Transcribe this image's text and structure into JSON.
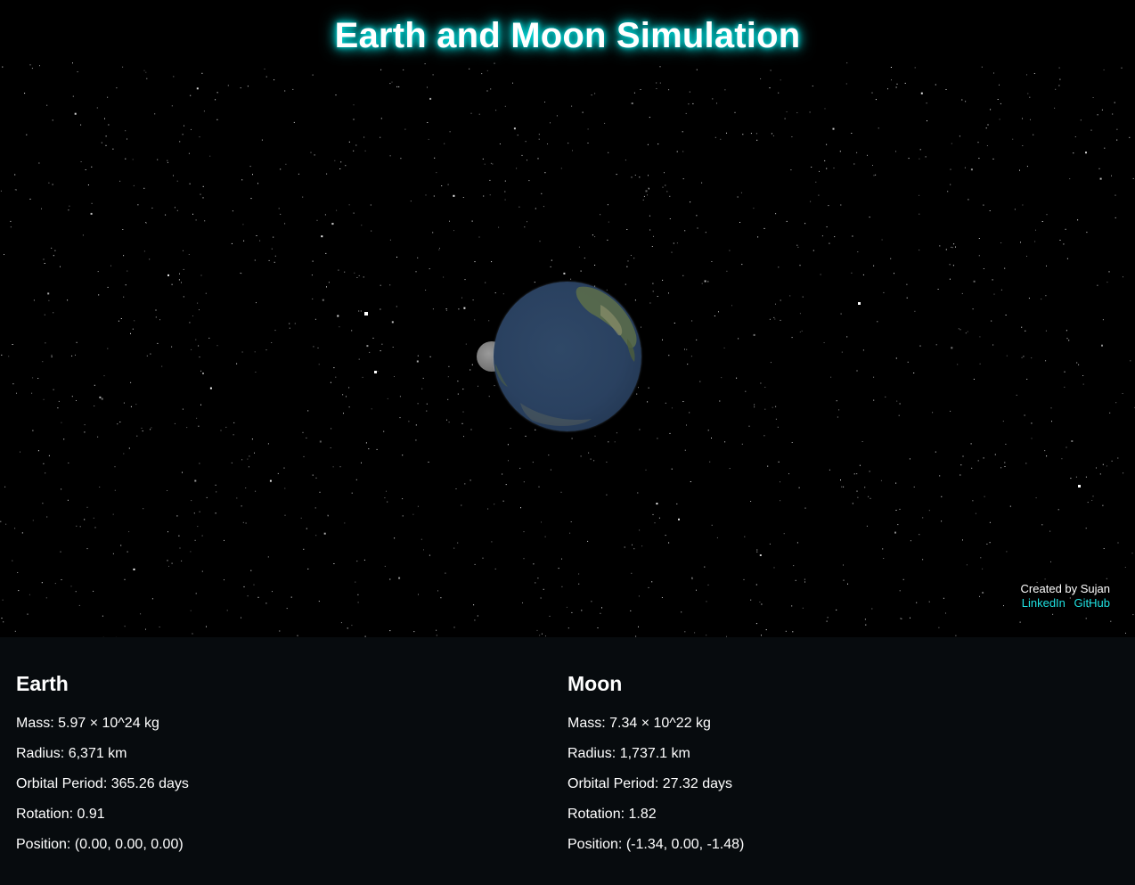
{
  "page": {
    "title": "Earth and Moon Simulation"
  },
  "credits": {
    "created_by": "Created by Sujan",
    "linkedin": "LinkedIn",
    "github": "GitHub"
  },
  "bodies": {
    "earth": {
      "name": "Earth",
      "mass": "Mass: 5.97 × 10^24 kg",
      "radius": "Radius: 6,371 km",
      "orbital_period": "Orbital Period: 365.26 days",
      "rotation": "Rotation: 0.91",
      "position": "Position: (0.00, 0.00, 0.00)"
    },
    "moon": {
      "name": "Moon",
      "mass": "Mass: 7.34 × 10^22 kg",
      "radius": "Radius: 1,737.1 km",
      "orbital_period": "Orbital Period: 27.32 days",
      "rotation": "Rotation: 1.82",
      "position": "Position: (-1.34, 0.00, -1.48)"
    }
  },
  "colors": {
    "background": "#000000",
    "panel": "#070b0e",
    "title_glow": "#00e5e5",
    "link": "#1fe0e0",
    "text": "#ffffff"
  }
}
